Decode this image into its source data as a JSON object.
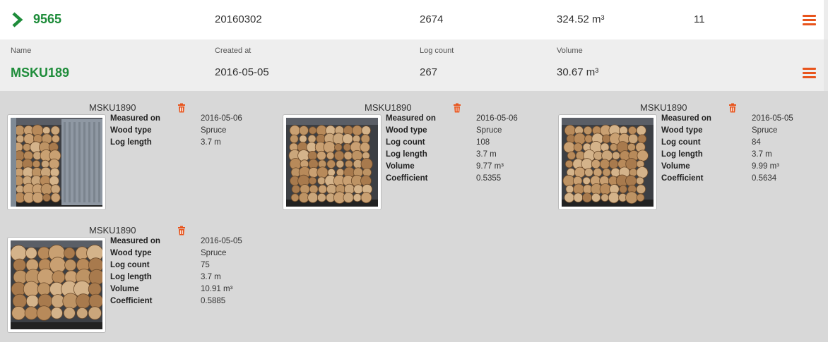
{
  "batch": {
    "id": "9565",
    "code": "20160302",
    "log_count": "2674",
    "volume": "324.52 m³",
    "count": "11"
  },
  "container": {
    "labels": {
      "name": "Name",
      "created_at": "Created at",
      "log_count": "Log count",
      "volume": "Volume"
    },
    "name": "MSKU189",
    "created_at": "2016-05-05",
    "log_count": "267",
    "volume": "30.67 m³"
  },
  "measurements": [
    {
      "title": "MSKU1890",
      "props": [
        [
          "Measured on",
          "2016-05-06"
        ],
        [
          "Wood type",
          "Spruce"
        ],
        [
          "Log length",
          "3.7 m"
        ]
      ]
    },
    {
      "title": "MSKU1890",
      "props": [
        [
          "Measured on",
          "2016-05-06"
        ],
        [
          "Wood type",
          "Spruce"
        ],
        [
          "Log count",
          "108"
        ],
        [
          "Log length",
          "3.7 m"
        ],
        [
          "Volume",
          "9.77 m³"
        ],
        [
          "Coefficient",
          "0.5355"
        ]
      ]
    },
    {
      "title": "MSKU1890",
      "props": [
        [
          "Measured on",
          "2016-05-05"
        ],
        [
          "Wood type",
          "Spruce"
        ],
        [
          "Log count",
          "84"
        ],
        [
          "Log length",
          "3.7 m"
        ],
        [
          "Volume",
          "9.99 m³"
        ],
        [
          "Coefficient",
          "0.5634"
        ]
      ]
    },
    {
      "title": "MSKU1890",
      "props": [
        [
          "Measured on",
          "2016-05-05"
        ],
        [
          "Wood type",
          "Spruce"
        ],
        [
          "Log count",
          "75"
        ],
        [
          "Log length",
          "3.7 m"
        ],
        [
          "Volume",
          "10.91 m³"
        ],
        [
          "Coefficient",
          "0.5885"
        ]
      ]
    }
  ],
  "colors": {
    "accent_green": "#1e8c3a",
    "menu_orange": "#e8541c"
  },
  "icons": {
    "expand": "chevron-right-icon",
    "menu": "hamburger-menu-icon",
    "delete": "trash-icon"
  }
}
